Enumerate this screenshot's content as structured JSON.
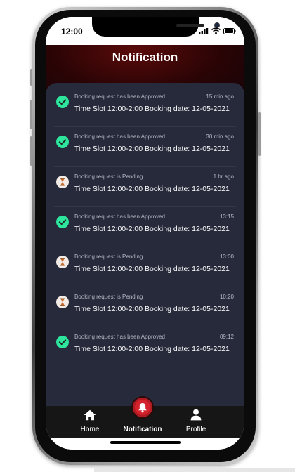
{
  "status_bar": {
    "time": "12:00"
  },
  "header": {
    "title": "Notification"
  },
  "notifications": [
    {
      "status": "approved",
      "title": "Booking request has been Approved",
      "time": "15 min ago",
      "detail": "Time Slot 12:00-2:00  Booking date: 12-05-2021"
    },
    {
      "status": "approved",
      "title": "Booking request has been Approved",
      "time": "30 min ago",
      "detail": "Time Slot 12:00-2:00  Booking date: 12-05-2021"
    },
    {
      "status": "pending",
      "title": "Booking request is Pending",
      "time": "1 hr ago",
      "detail": "Time Slot 12:00-2:00  Booking date: 12-05-2021"
    },
    {
      "status": "approved",
      "title": "Booking request has been Approved",
      "time": "13:15",
      "detail": "Time Slot 12:00-2:00  Booking date: 12-05-2021"
    },
    {
      "status": "pending",
      "title": "Booking request is Pending",
      "time": "13:00",
      "detail": "Time Slot 12:00-2:00  Booking date: 12-05-2021"
    },
    {
      "status": "pending",
      "title": "Booking request is Pending",
      "time": "10:20",
      "detail": "Time Slot 12:00-2:00  Booking date: 12-05-2021"
    },
    {
      "status": "approved",
      "title": "Booking request has been Approved",
      "time": "09:12",
      "detail": "Time Slot 12:00-2:00  Booking date: 12-05-2021"
    }
  ],
  "nav": {
    "home": {
      "label": "Home",
      "icon": "home-icon"
    },
    "notification": {
      "label": "Notification",
      "icon": "bell-icon",
      "active": true
    },
    "profile": {
      "label": "Profile",
      "icon": "user-icon"
    }
  },
  "colors": {
    "approved": "#2ee59d",
    "pending_bg": "#f3ece6",
    "pending_glyph": "#c96a2a",
    "accent": "#d4222c",
    "panel": "#262a3a"
  }
}
